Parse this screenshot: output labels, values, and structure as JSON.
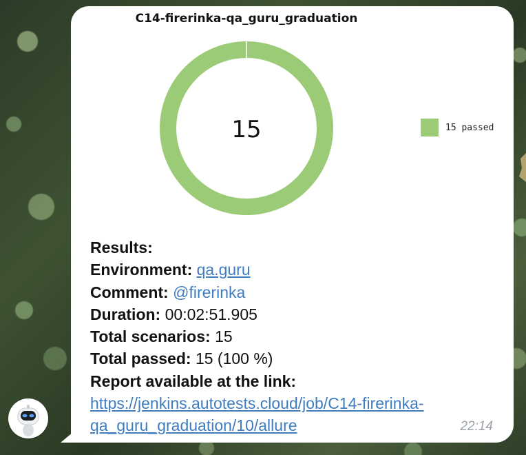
{
  "chart": {
    "title": "C14-firerinka-qa_guru_graduation",
    "center_value": "15",
    "legend": [
      {
        "label": "15 passed",
        "color": "#9ccb78"
      }
    ]
  },
  "chart_data": {
    "type": "pie",
    "title": "C14-firerinka-qa_guru_graduation",
    "categories": [
      "passed"
    ],
    "values": [
      15
    ],
    "series": [
      {
        "name": "15 passed",
        "values": [
          15
        ]
      }
    ],
    "colors": [
      "#9ccb78"
    ],
    "center_label": "15",
    "legend_position": "right"
  },
  "message": {
    "results_label": "Results:",
    "environment_label": "Environment:",
    "environment_value": "qa.guru",
    "comment_label": "Comment:",
    "comment_value": "@firerinka",
    "duration_label": "Duration:",
    "duration_value": "00:02:51.905",
    "total_scenarios_label": "Total scenarios:",
    "total_scenarios_value": "15",
    "total_passed_label": "Total passed:",
    "total_passed_value": "15 (100 %)",
    "report_label": "Report available at the link:",
    "report_link": "https://jenkins.autotests.cloud/job/C14-firerinka-qa_guru_graduation/10/allure",
    "time": "22:14"
  },
  "icons": {
    "avatar": "robot-avatar-icon"
  },
  "colors": {
    "passed": "#9ccb78",
    "link": "#3f7dc0",
    "bubble": "#ffffff",
    "timestamp": "#9aa1a8"
  }
}
